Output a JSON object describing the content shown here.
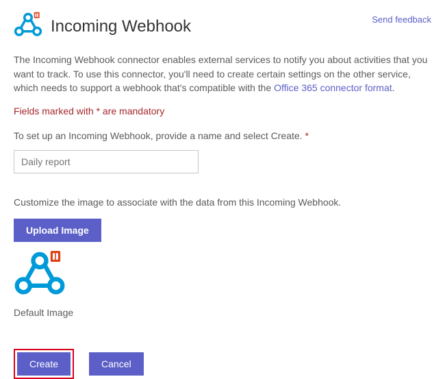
{
  "header": {
    "title": "Incoming Webhook",
    "feedback_link": "Send feedback"
  },
  "description": {
    "text_before_link": "The Incoming Webhook connector enables external services to notify you about activities that you want to track. To use this connector, you'll need to create certain settings on the other service, which needs to support a webhook that's compatible with the ",
    "link_text": "Office 365 connector format",
    "text_after_link": "."
  },
  "mandatory_note": "Fields marked with * are mandatory",
  "setup": {
    "label": "To set up an Incoming Webhook, provide a name and select Create. ",
    "required_mark": "*",
    "input_value": "Daily report"
  },
  "image_section": {
    "customize_text": "Customize the image to associate with the data from this Incoming Webhook.",
    "upload_button": "Upload Image",
    "default_image_label": "Default Image"
  },
  "footer": {
    "create_button": "Create",
    "cancel_button": "Cancel"
  },
  "colors": {
    "accent": "#5b5fc7",
    "icon_blue": "#009ad9",
    "office_orange": "#dc3e15",
    "error_red": "#a4262c",
    "highlight_border": "#d9001b"
  }
}
